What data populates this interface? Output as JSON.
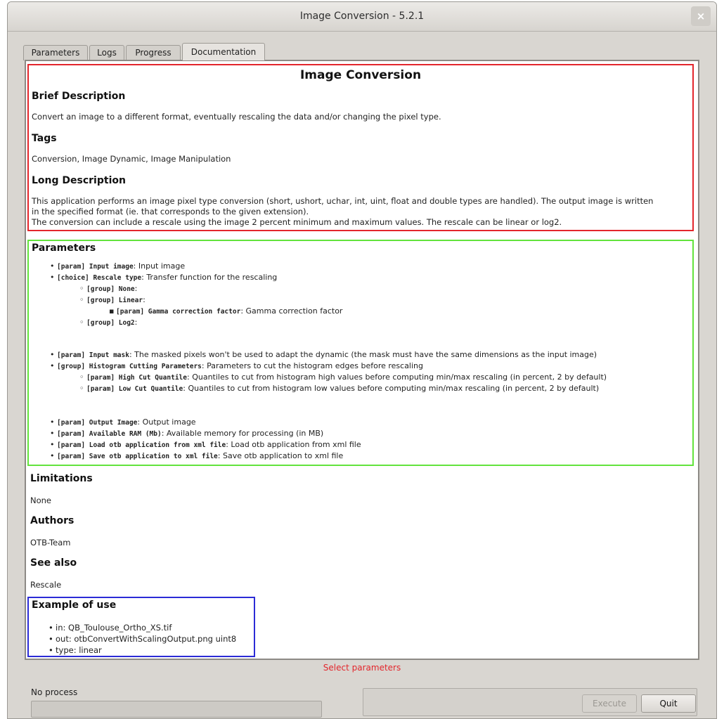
{
  "window": {
    "title": "Image Conversion - 5.2.1",
    "close_icon": "×"
  },
  "tabs": [
    {
      "label": "Parameters"
    },
    {
      "label": "Logs"
    },
    {
      "label": "Progress"
    },
    {
      "label": "Documentation"
    }
  ],
  "doc": {
    "title": "Image Conversion",
    "brief_heading": "Brief Description",
    "brief_text": "Convert an image to a different format, eventually rescaling the data and/or changing the pixel type.",
    "tags_heading": "Tags",
    "tags_text": "Conversion, Image Dynamic, Image Manipulation",
    "long_heading": "Long Description",
    "long_lines": [
      "This application performs an image pixel type conversion (short, ushort, uchar, int, uint, float and double types are handled). The output image is written",
      "in the specified format (ie. that corresponds to the given extension).",
      " The conversion can include a rescale using the image 2 percent minimum and maximum values. The rescale can be linear or log2."
    ],
    "params_heading": "Parameters",
    "params": [
      {
        "kind": "[param] Input image",
        "desc": "Input image"
      },
      {
        "kind": "[choice] Rescale type",
        "desc": "Transfer function for the rescaling"
      },
      {
        "kind": "[group] None",
        "desc": ""
      },
      {
        "kind": "[group] Linear",
        "desc": ""
      },
      {
        "kind": "[param] Gamma correction factor",
        "desc": "Gamma correction factor"
      },
      {
        "kind": "[group] Log2",
        "desc": ""
      },
      {
        "kind": "[param] Input mask",
        "desc": "The masked pixels won't be used to adapt the dynamic (the mask must have the same dimensions as the input image)"
      },
      {
        "kind": "[group] Histogram Cutting Parameters",
        "desc": "Parameters to cut the histogram edges before rescaling"
      },
      {
        "kind": "[param] High Cut Quantile",
        "desc": "Quantiles to cut from histogram high values before computing min/max rescaling (in percent, 2 by default)"
      },
      {
        "kind": "[param] Low Cut Quantile",
        "desc": "Quantiles to cut from histogram low values before computing min/max rescaling (in percent, 2 by default)"
      },
      {
        "kind": "[param] Output Image",
        "desc": "Output image"
      },
      {
        "kind": "[param] Available RAM (Mb)",
        "desc": "Available memory for processing (in MB)"
      },
      {
        "kind": "[param] Load otb application from xml file",
        "desc": "Load otb application from xml file"
      },
      {
        "kind": "[param] Save otb application to xml file",
        "desc": "Save otb application to xml file"
      }
    ],
    "limitations_heading": "Limitations",
    "limitations_text": "None",
    "authors_heading": "Authors",
    "authors_text": "OTB-Team",
    "seealso_heading": "See also",
    "seealso_text": "Rescale",
    "example_heading": "Example of use",
    "example_items": [
      "in: QB_Toulouse_Ortho_XS.tif",
      "out: otbConvertWithScalingOutput.png uint8",
      "type: linear"
    ]
  },
  "status": {
    "message": "Select parameters",
    "process_label": "No process"
  },
  "buttons": {
    "execute": "Execute",
    "quit": "Quit"
  },
  "colors": {
    "red_frame": "#e3262c",
    "green_frame": "#63e33c",
    "blue_frame": "#2b2bd6"
  }
}
